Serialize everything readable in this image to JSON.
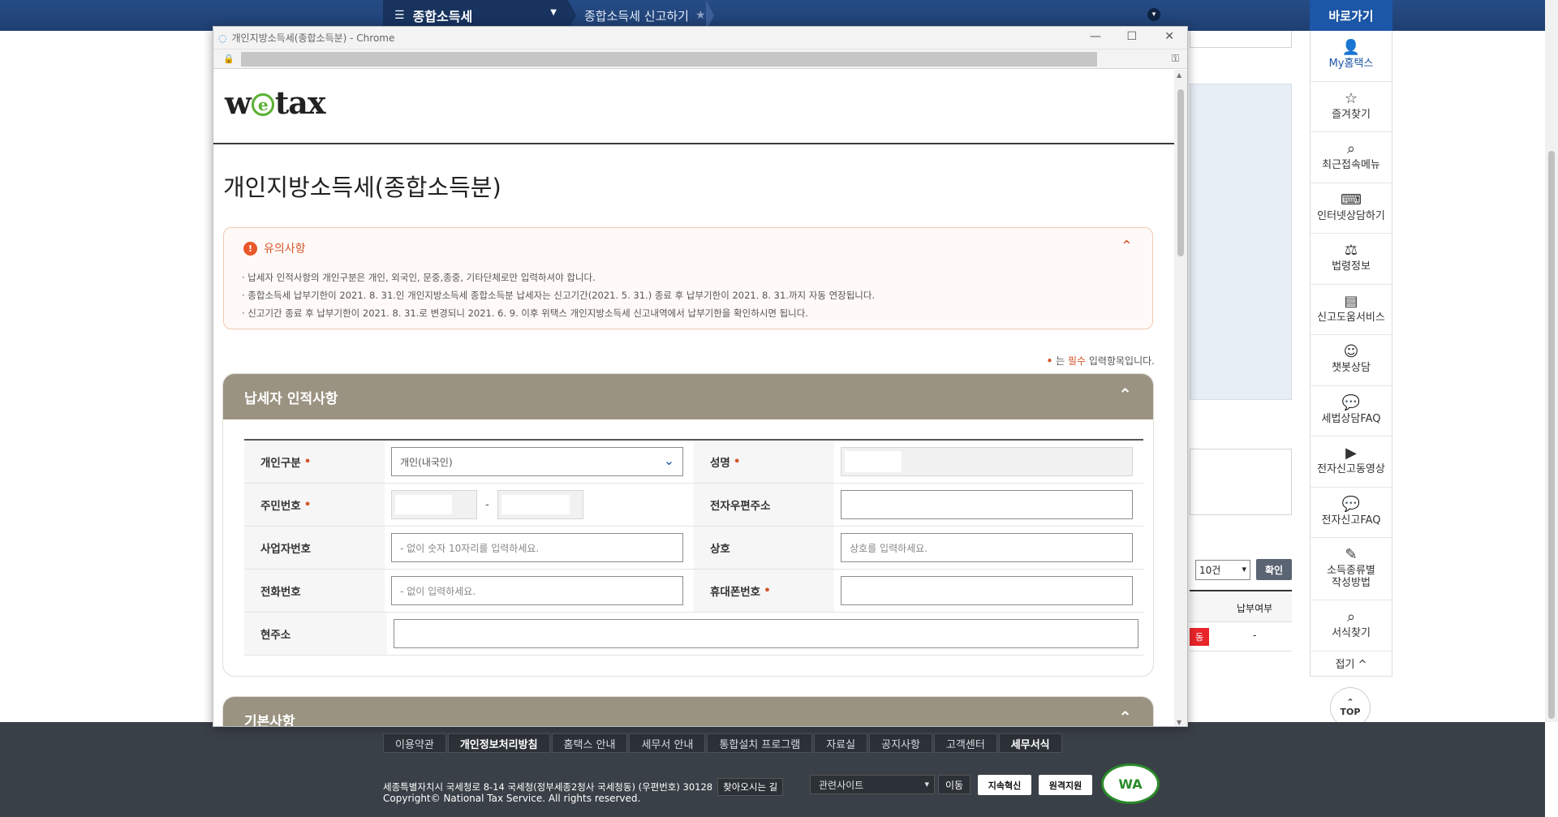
{
  "site": {
    "menu_title": "종합소득세",
    "breadcrumb": "종합소득세 신고하기",
    "quick_title": "바로가기",
    "quick_items": [
      "My홈택스",
      "즐겨찾기",
      "최근접속메뉴",
      "인터넷상담하기",
      "법령정보",
      "신고도움서비스",
      "챗봇상담",
      "세법상담FAQ",
      "전자신고동영상",
      "전자신고FAQ",
      "소득종류별\n작성방법",
      "서식찾기"
    ],
    "quick_fold": "접기 ^",
    "top_label": "TOP",
    "bg_select": "10건",
    "bg_confirm": "확인",
    "bg_col": "납부여부",
    "bg_red": "동",
    "bg_dash": "-"
  },
  "footer": {
    "nav": [
      "이용약관",
      "개인정보처리방침",
      "홈택스 안내",
      "세무서 안내",
      "통합설치 프로그램",
      "자료실",
      "공지사항",
      "고객센터",
      "세무서식"
    ],
    "address": "세종특별자치시 국세청로 8-14 국세청(정부세종2청사 국세청동) (우편번호) 30128",
    "directions": "찾아오시는 길",
    "copyright": "Copyright© National Tax Service. All rights reserved.",
    "related": "관련사이트",
    "go": "이동",
    "badge1": "지속혁신",
    "badge2": "원격지원",
    "wa": "WA"
  },
  "popup": {
    "window_title": "개인지방소득세(종합소득분) - Chrome",
    "brand": {
      "w": "w",
      "e": "e",
      "tax": "tax"
    },
    "page_title": "개인지방소득세(종합소득분)",
    "notice": {
      "title": "유의사항",
      "lines": [
        "· 납세자 인적사항의 개인구분은 개인, 외국인, 문중,종중, 기타단체로만 입력하셔야 합니다.",
        "· 종합소득세 납부기한이 2021. 8. 31.인 개인지방소득세 종합소득분 납세자는 신고기간(2021. 5. 31.) 종료 후 납부기한이 2021. 8. 31.까지 자동 연장됩니다.",
        "· 신고기간 종료 후 납부기한이 2021. 8. 31.로 변경되니 2021. 6. 9. 이후 위택스 개인지방소득세 신고내역에서 납부기한을 확인하시면 됩니다."
      ]
    },
    "required_note": {
      "dot": "•",
      "pre": " 는 ",
      "must": "필수",
      "post": " 입력항목입니다."
    },
    "section1": {
      "title": "납세자 인적사항",
      "labels": {
        "type": "개인구분",
        "name": "성명",
        "rrn": "주민번호",
        "email": "전자우편주소",
        "bizno": "사업자번호",
        "company": "상호",
        "phone": "전화번호",
        "mobile": "휴대폰번호",
        "address": "현주소"
      },
      "type_value": "개인(내국인)",
      "rrn_dash": "-",
      "bizno_placeholder": "- 없이 숫자 10자리를 입력하세요.",
      "company_placeholder": "상호를 입력하세요.",
      "phone_placeholder": "- 없이 입력하세요.",
      "required_star": "•"
    },
    "section2": {
      "title": "기본사항"
    }
  }
}
